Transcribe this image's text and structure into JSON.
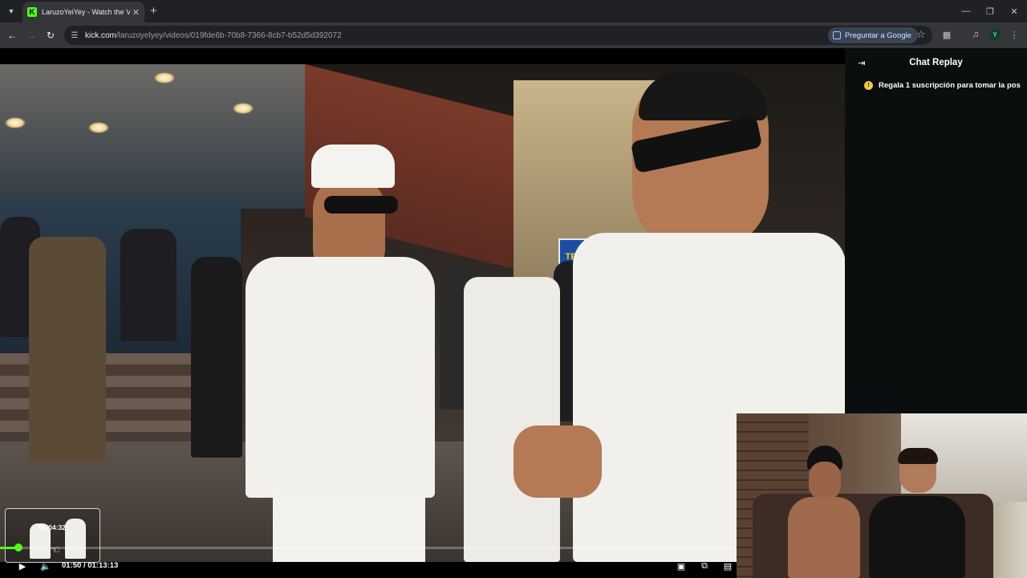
{
  "browser": {
    "tab_title": "LaruzoYeiYey - Watch the VOD",
    "favicon_letter": "K",
    "url_host": "kick.com",
    "url_path": "/laruzoyelyey/videos/019fde6b-70b8-7366-8cb7-b52d5d392072",
    "ask_google_label": "Preguntar a Google",
    "profile_initial": "Y",
    "icons": {
      "tab_search": "chevron-down-icon",
      "tab_close": "close-icon",
      "new_tab": "plus-icon",
      "minimize": "minimize-icon",
      "restore": "restore-icon",
      "close": "close-icon",
      "back": "back-arrow-icon",
      "forward": "forward-arrow-icon",
      "reload": "reload-icon",
      "site_info": "tune-icon",
      "bookmark": "star-icon",
      "extensions": "puzzle-icon",
      "media": "media-control-icon",
      "menu": "kebab-menu-icon"
    }
  },
  "chat": {
    "title": "Chat Replay",
    "pinned_message": "Regala 1 suscripción para tomar la pos",
    "icons": {
      "collapse": "collapse-sidebar-icon",
      "gift": "coin-icon"
    }
  },
  "video": {
    "storefront_sign": "TEDi"
  },
  "player": {
    "hover_time": "00:04:32",
    "current_time": "01:50",
    "duration": "01:13:13",
    "time_separator": " / ",
    "progress_fraction": 0.025,
    "accent_color": "#53fc18",
    "icons": {
      "play": "play-icon",
      "volume": "volume-icon",
      "theater": "theater-mode-icon",
      "pip": "picture-in-picture-icon",
      "captions": "captions-icon"
    }
  }
}
